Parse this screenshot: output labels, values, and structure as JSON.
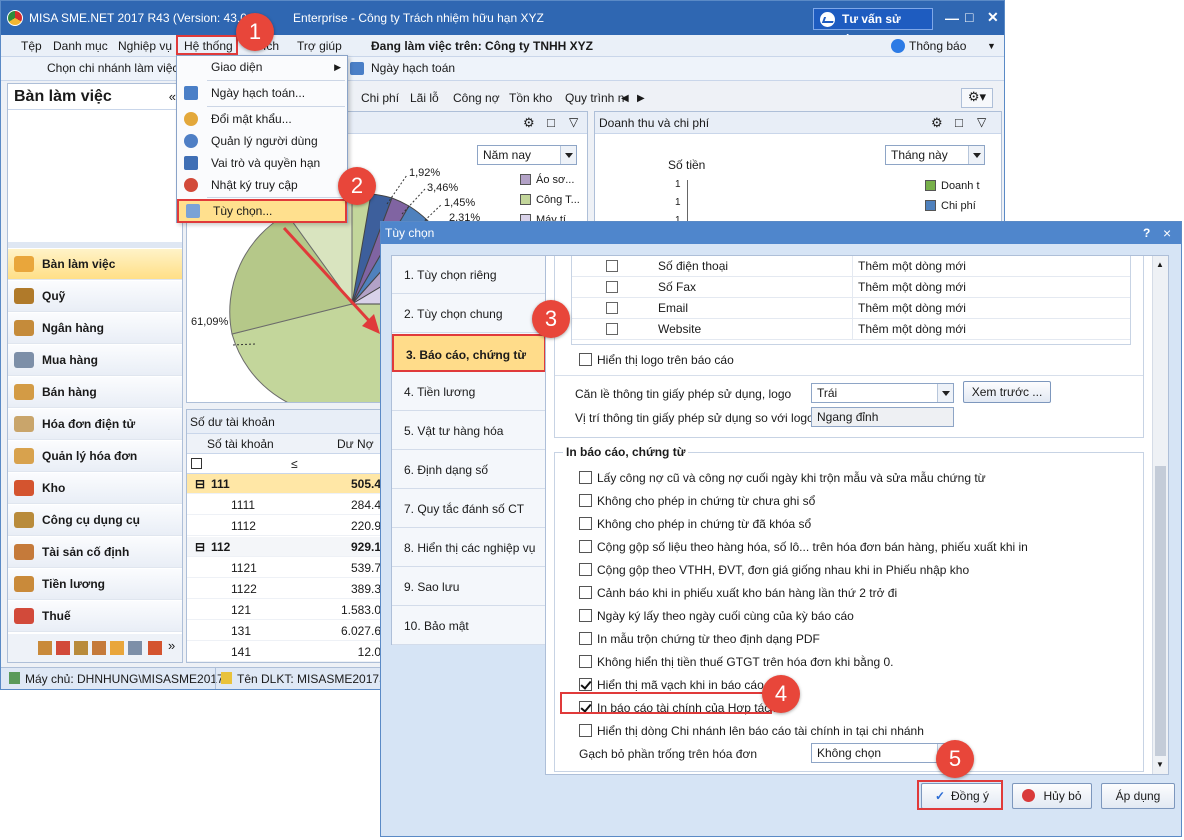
{
  "window": {
    "title": "MISA SME.NET 2017 R43 (Version: 43.0",
    "title_suffix": "Enterprise - Công ty Trách nhiệm hữu hạn XYZ",
    "support_button": "Tư vấn sử dụng"
  },
  "menubar": {
    "items": [
      "Tệp",
      "Danh mục",
      "Nghiệp vụ",
      "Hệ thống",
      "ích",
      "Trợ giúp"
    ],
    "working_on_label": "Đang làm việc trên:",
    "working_on_value": "Công ty TNHH XYZ",
    "notification": "Thông báo"
  },
  "toolbar": {
    "branch_label": "Chọn chi nhánh làm việc",
    "accounting_date": "Ngày hạch toán"
  },
  "system_menu": {
    "items": [
      "Giao diện",
      "Ngày hạch toán...",
      "Đổi mật khẩu...",
      "Quản lý người dùng",
      "Vai trò và quyền hạn",
      "Nhật ký truy cập",
      "Tùy chọn..."
    ]
  },
  "sidebar": {
    "header": "Bàn làm việc",
    "items": [
      "Bàn làm việc",
      "Quỹ",
      "Ngân hàng",
      "Mua hàng",
      "Bán hàng",
      "Hóa đơn điện tử",
      "Quản lý hóa đơn",
      "Kho",
      "Công cụ dụng cụ",
      "Tài sản cố định",
      "Tiền lương",
      "Thuế"
    ]
  },
  "content_tabs": [
    "Chi phí",
    "Lãi lỗ",
    "Công nợ",
    "Tồn kho",
    "Quy trình n"
  ],
  "pie_panel": {
    "period": "Năm nay",
    "labels": [
      "1,92%",
      "3,46%",
      "1,45%",
      "2,31%",
      "61,09%"
    ],
    "legend": [
      "Áo sơ...",
      "Công T...",
      "Máy tí..."
    ]
  },
  "revenue_panel": {
    "title": "Doanh thu và chi phí",
    "period": "Tháng này",
    "ylabel": "Số tiền",
    "ticks": [
      "1",
      "1",
      "1",
      "1"
    ],
    "legend": [
      "Doanh t",
      "Chi phí"
    ]
  },
  "balance_panel": {
    "title": "Số dư tài khoản",
    "col_account": "Số tài khoản",
    "col_debit": "Dư Nợ",
    "filter_symbol": "≤",
    "rows": [
      {
        "account": "111",
        "value": "505.4",
        "group": true
      },
      {
        "account": "1111",
        "value": "284.4",
        "group": false
      },
      {
        "account": "1112",
        "value": "220.9",
        "group": false
      },
      {
        "account": "112",
        "value": "929.1",
        "group": true
      },
      {
        "account": "1121",
        "value": "539.7",
        "group": false
      },
      {
        "account": "1122",
        "value": "389.3",
        "group": false
      },
      {
        "account": "121",
        "value": "1.583.0",
        "group": false
      },
      {
        "account": "131",
        "value": "6.027.6",
        "group": false
      },
      {
        "account": "141",
        "value": "12.0",
        "group": false
      }
    ]
  },
  "statusbar": {
    "server": "Máy chủ: DHNHUNG\\MISASME2017",
    "db": "Tên DLKT: MISASME2017Sa"
  },
  "dialog": {
    "title": "Tùy chọn",
    "help": "?",
    "close": "×",
    "tabs": [
      "1. Tùy chọn riêng",
      "2. Tùy chọn chung",
      "3. Báo cáo, chứng từ",
      "4. Tiền lương",
      "5. Vật tư hàng hóa",
      "6. Định dạng số",
      "7. Quy tắc đánh số CT",
      "8. Hiển thị các nghiệp vụ",
      "9. Sao lưu",
      "10. Bảo mật"
    ],
    "info_rows": [
      {
        "name": "Số điện thoại",
        "action": "Thêm một dòng mới"
      },
      {
        "name": "Số Fax",
        "action": "Thêm một dòng mới"
      },
      {
        "name": "Email",
        "action": "Thêm một dòng mới"
      },
      {
        "name": "Website",
        "action": "Thêm một dòng mới"
      }
    ],
    "show_logo": "Hiển thị logo trên báo cáo",
    "logo_align_label": "Căn lề thông tin giấy phép sử dụng, logo",
    "logo_align_value": "Trái",
    "preview_button": "Xem trước ...",
    "license_pos_label": "Vị trí thông tin giấy phép sử dụng so với logo",
    "license_pos_value": "Ngang đỉnh",
    "print_group": "In báo cáo, chứng từ",
    "options": [
      {
        "label": "Lấy công nợ cũ và công nợ cuối ngày khi trộn mẫu và sửa mẫu chứng từ",
        "checked": false
      },
      {
        "label": "Không cho phép in chứng từ chưa ghi sổ",
        "checked": false
      },
      {
        "label": "Không cho phép in chứng từ đã khóa sổ",
        "checked": false
      },
      {
        "label": "Cộng gộp số liệu theo hàng hóa, số lô... trên hóa đơn bán hàng, phiếu xuất khi in",
        "checked": false
      },
      {
        "label": "Cộng gộp theo VTHH, ĐVT, đơn giá giống nhau khi in Phiếu nhập kho",
        "checked": false
      },
      {
        "label": "Cảnh báo khi in phiếu xuất kho bán hàng lần thứ 2 trở đi",
        "checked": false
      },
      {
        "label": "Ngày ký lấy theo ngày cuối cùng của kỳ báo cáo",
        "checked": false
      },
      {
        "label": "In mẫu trộn chứng từ theo định dạng PDF",
        "checked": false
      },
      {
        "label": "Không hiển thị tiền thuế GTGT trên hóa đơn khi bằng 0.",
        "checked": false
      },
      {
        "label": "Hiển thị mã vạch khi in báo cáo, chứ",
        "checked": true
      },
      {
        "label": "In báo cáo tài chính của Hợp tác xã",
        "checked": true
      },
      {
        "label": "Hiển thị dòng Chi nhánh lên báo cáo tài chính in tại chi nhánh",
        "checked": false
      }
    ],
    "strike_label": "Gạch bỏ phần trống trên hóa đơn",
    "strike_value": "Không chọn",
    "ok_button": "Đồng ý",
    "cancel_button": "Hủy bỏ",
    "apply_button": "Áp dụng"
  },
  "callouts": [
    "1",
    "2",
    "3",
    "4",
    "5"
  ],
  "colors": {
    "titlebar": "#2f67b2",
    "highlight": "#ffdc8a",
    "callout": "#e8463a"
  }
}
